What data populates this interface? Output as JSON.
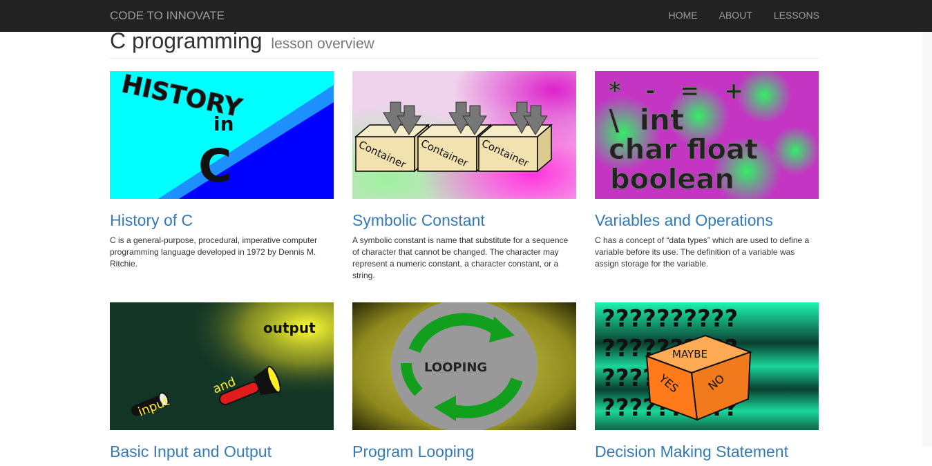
{
  "navbar": {
    "brand": "CODE TO INNOVATE",
    "links": [
      "HOME",
      "ABOUT",
      "LESSONS"
    ]
  },
  "page": {
    "title": "C programming",
    "subtitle": "lesson overview"
  },
  "lessons": [
    {
      "title": "History of C",
      "description": "C is a general-purpose, procedural, imperative computer programming language developed in 1972 by Dennis M. Ritchie.",
      "image_text": [
        "HISTORY",
        "in",
        "C"
      ]
    },
    {
      "title": "Symbolic Constant",
      "description": "A symbolic constant is name that substitute for a sequence of character that cannot be changed. The character may represent a numeric constant, a character constant, or a string.",
      "image_text": [
        "Container",
        "Container",
        "Container"
      ]
    },
    {
      "title": "Variables and Operations",
      "description": "C has a concept of “data types” which are used to define a variable before its use. The definition of a variable was assign storage for the variable.",
      "image_text": [
        "*   -   =   +",
        "\\  int",
        "char float",
        "boolean"
      ]
    },
    {
      "title": "Basic Input and Output",
      "description": "",
      "image_text": [
        "output",
        "and",
        "input"
      ]
    },
    {
      "title": "Program Looping",
      "description": "",
      "image_text": [
        "LOOPING"
      ]
    },
    {
      "title": "Decision Making Statement",
      "description": "",
      "image_text": [
        "??????????",
        "MAYBE",
        "YES",
        "NO"
      ]
    }
  ]
}
